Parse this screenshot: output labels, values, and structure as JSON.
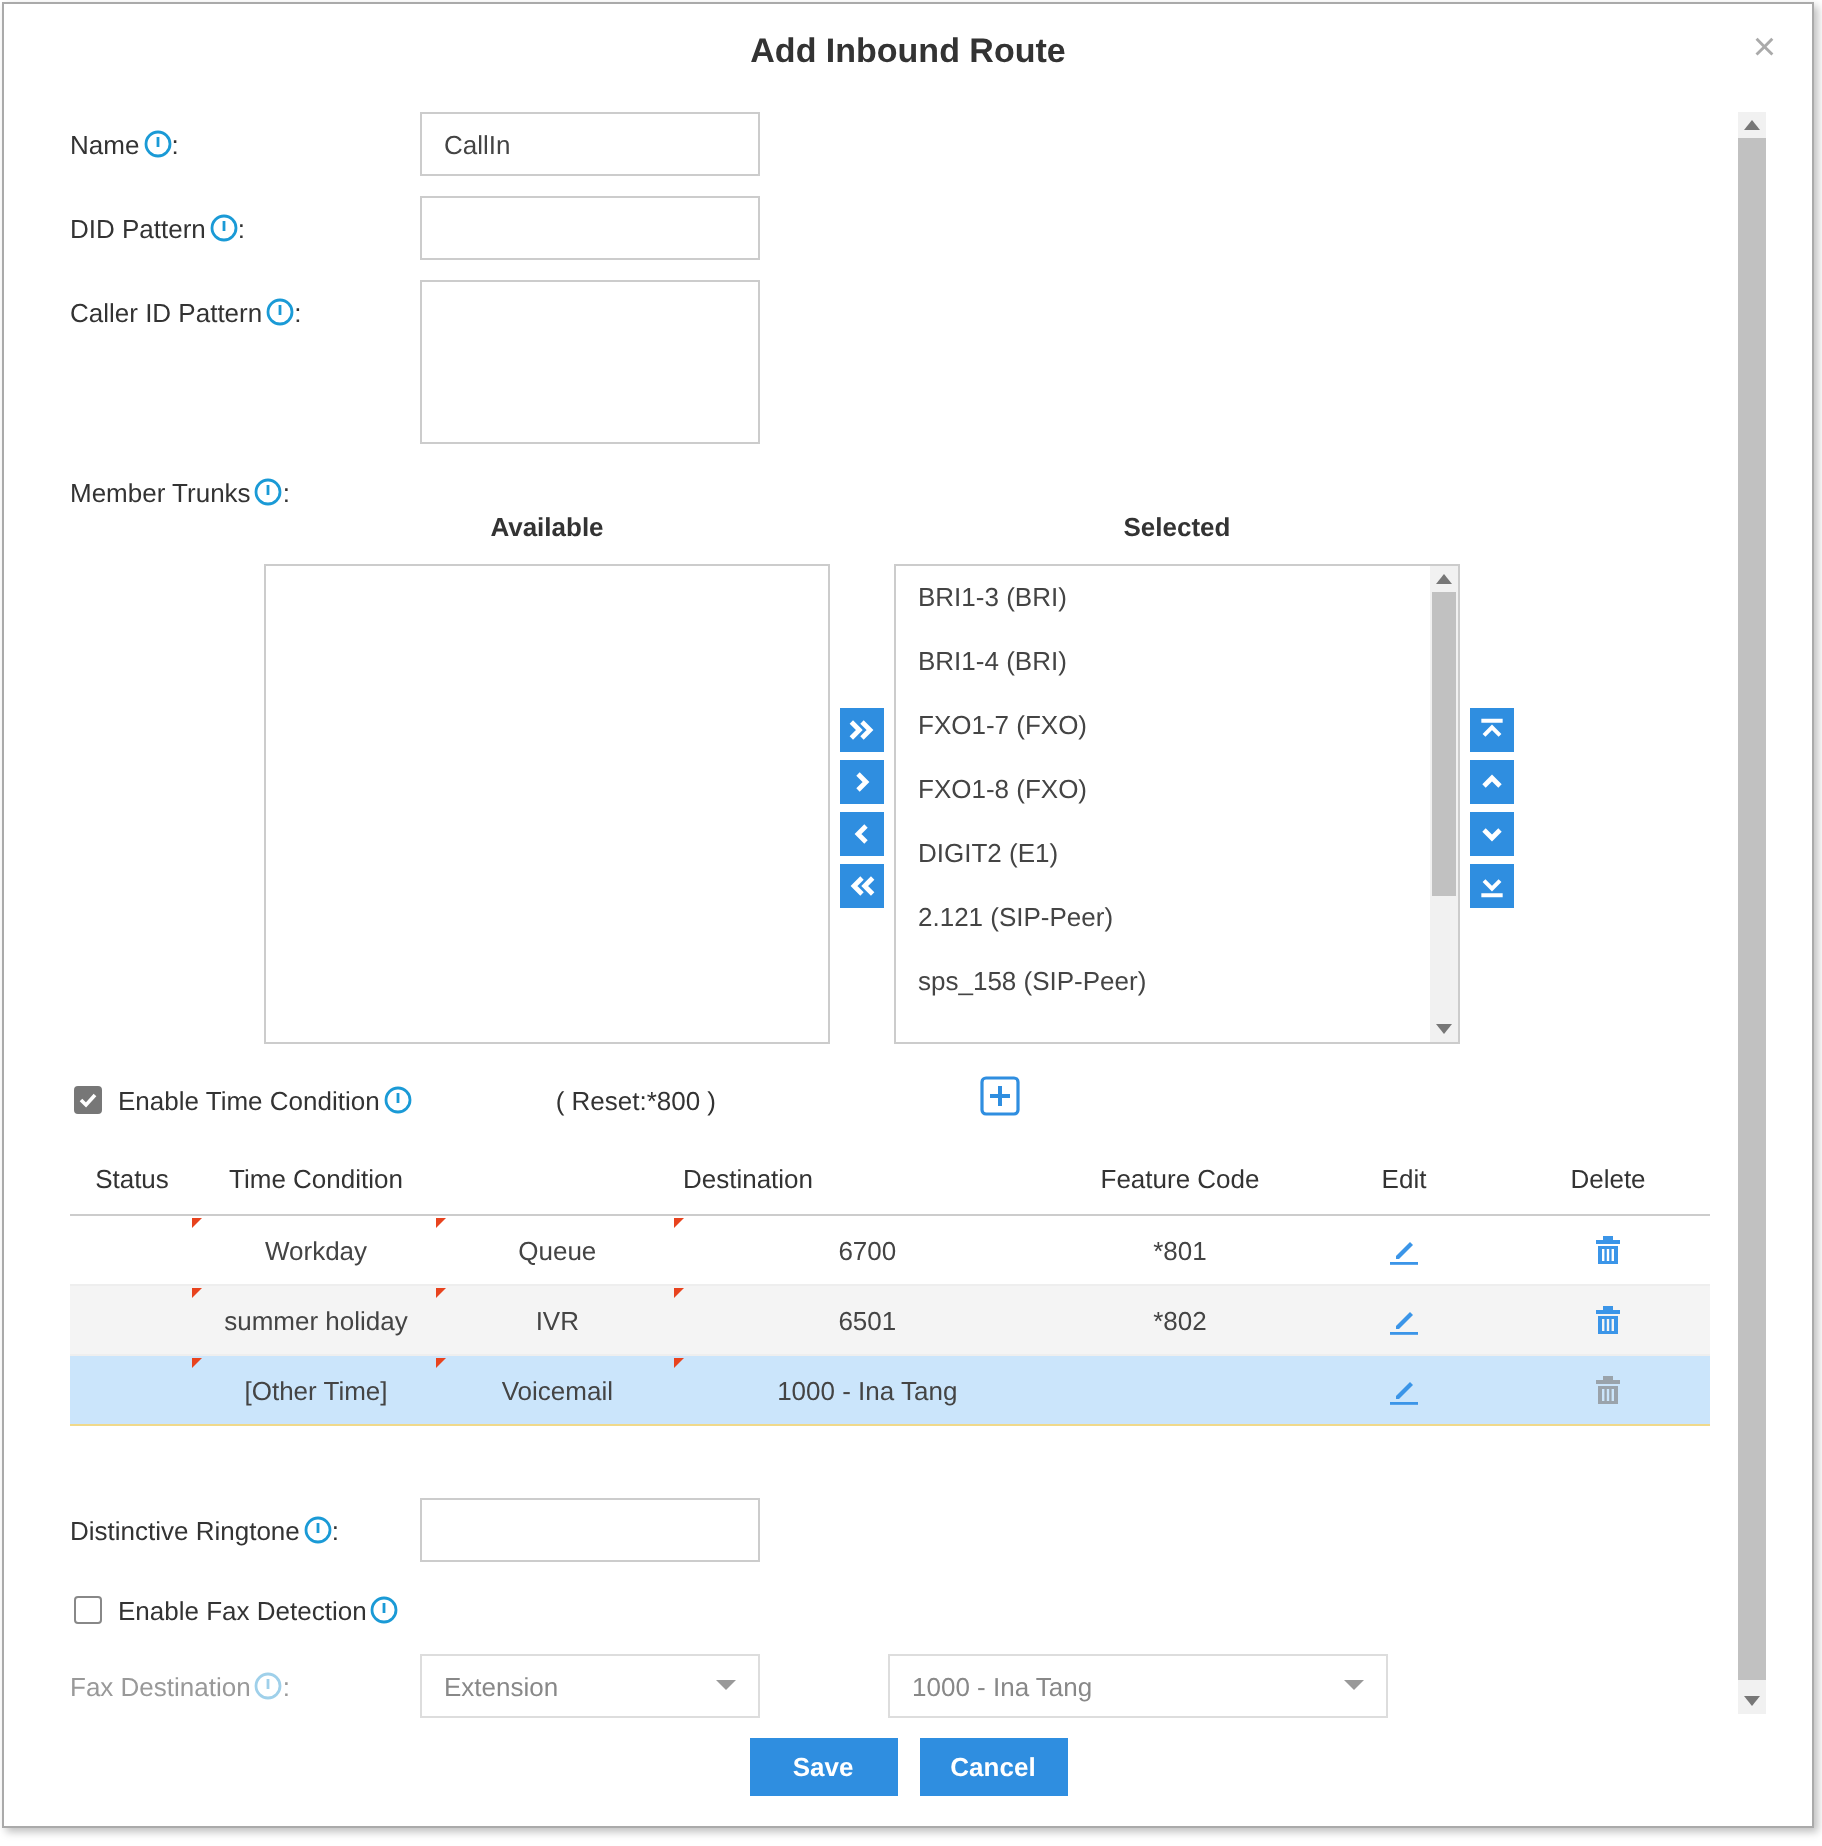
{
  "dialog": {
    "title": "Add Inbound Route",
    "close": "×"
  },
  "fields": [
    {
      "label": "Name",
      "colon": ":",
      "value": "CallIn",
      "kind": "input"
    },
    {
      "label": "DID Pattern",
      "colon": ":",
      "kind": "input"
    },
    {
      "label": "Caller ID Pattern",
      "colon": ":",
      "kind": "textarea"
    }
  ],
  "member_trunks": {
    "label": "Member Trunks",
    "colon": ":",
    "available_heading": "Available",
    "selected_heading": "Selected",
    "selected": [
      "BRI1-3 (BRI)",
      "BRI1-4 (BRI)",
      "FXO1-7 (FXO)",
      "FXO1-8 (FXO)",
      "DIGIT2 (E1)",
      "2.121 (SIP-Peer)",
      "sps_158 (SIP-Peer)"
    ]
  },
  "time_condition": {
    "label": "Enable Time Condition",
    "checked": true,
    "reset": "( Reset:*800 )"
  },
  "table": {
    "columns": [
      "Status",
      "Time Condition",
      "Destination",
      "Feature Code",
      "Edit",
      "Delete"
    ],
    "rows": [
      {
        "time_condition": "Workday",
        "destination_type": "Queue",
        "destination": "6700",
        "feature_code": "*801",
        "selected": false,
        "delete_disabled": false
      },
      {
        "time_condition": "summer holiday",
        "destination_type": "IVR",
        "destination": "6501",
        "feature_code": "*802",
        "selected": false,
        "delete_disabled": false
      },
      {
        "time_condition": "[Other Time]",
        "destination_type": "Voicemail",
        "destination": "1000 - Ina Tang",
        "selected": true,
        "delete_disabled": true
      }
    ]
  },
  "ringtone": {
    "label": "Distinctive Ringtone",
    "colon": ":"
  },
  "fax_detection": {
    "label": "Enable Fax Detection",
    "checked": false
  },
  "fax_destination": {
    "label": "Fax Destination",
    "colon": ":",
    "disabled": true,
    "type": "Extension",
    "target": "1000 - Ina Tang"
  },
  "buttons": [
    "Save",
    "Cancel"
  ]
}
